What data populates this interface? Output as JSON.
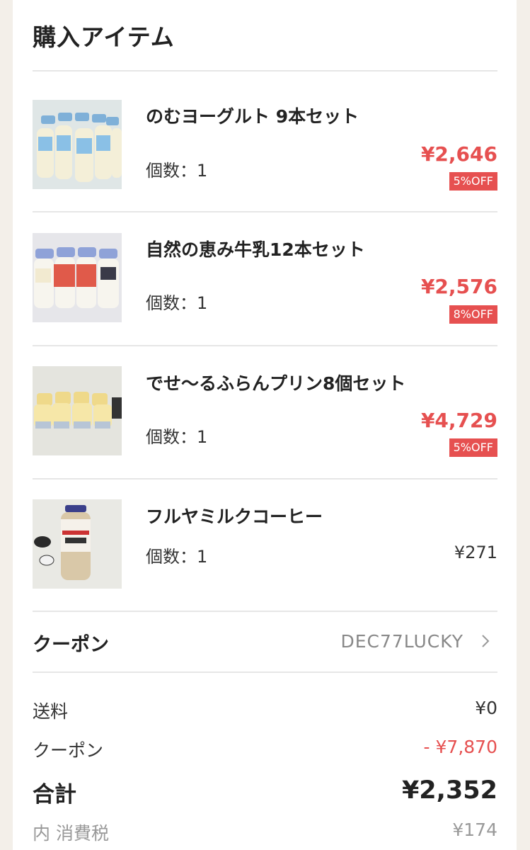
{
  "header": {
    "title": "購入アイテム"
  },
  "items": [
    {
      "name": "のむヨーグルト 9本セット",
      "qty": "個数：1",
      "price": "¥2,646",
      "off": "5%OFF"
    },
    {
      "name": "自然の恵み牛乳12本セット",
      "qty": "個数：1",
      "price": "¥2,576",
      "off": "8%OFF"
    },
    {
      "name": "でせ〜るふらんプリン8個セット",
      "qty": "個数：1",
      "price": "¥4,729",
      "off": "5%OFF"
    },
    {
      "name": "フルヤミルクコーヒー",
      "qty": "個数：1",
      "price": "¥271"
    }
  ],
  "coupon": {
    "label": "クーポン",
    "code": "DEC77LUCKY"
  },
  "summary": {
    "shipping_label": "送料",
    "shipping_value": "¥0",
    "coupon_label": "クーポン",
    "coupon_value": "- ¥7,870",
    "total_label": "合計",
    "total_value": "¥2,352",
    "tax_label": "内 消費税",
    "tax_value": "¥174"
  },
  "colors": {
    "accent": "#e65050",
    "background": "#f3efe9"
  }
}
